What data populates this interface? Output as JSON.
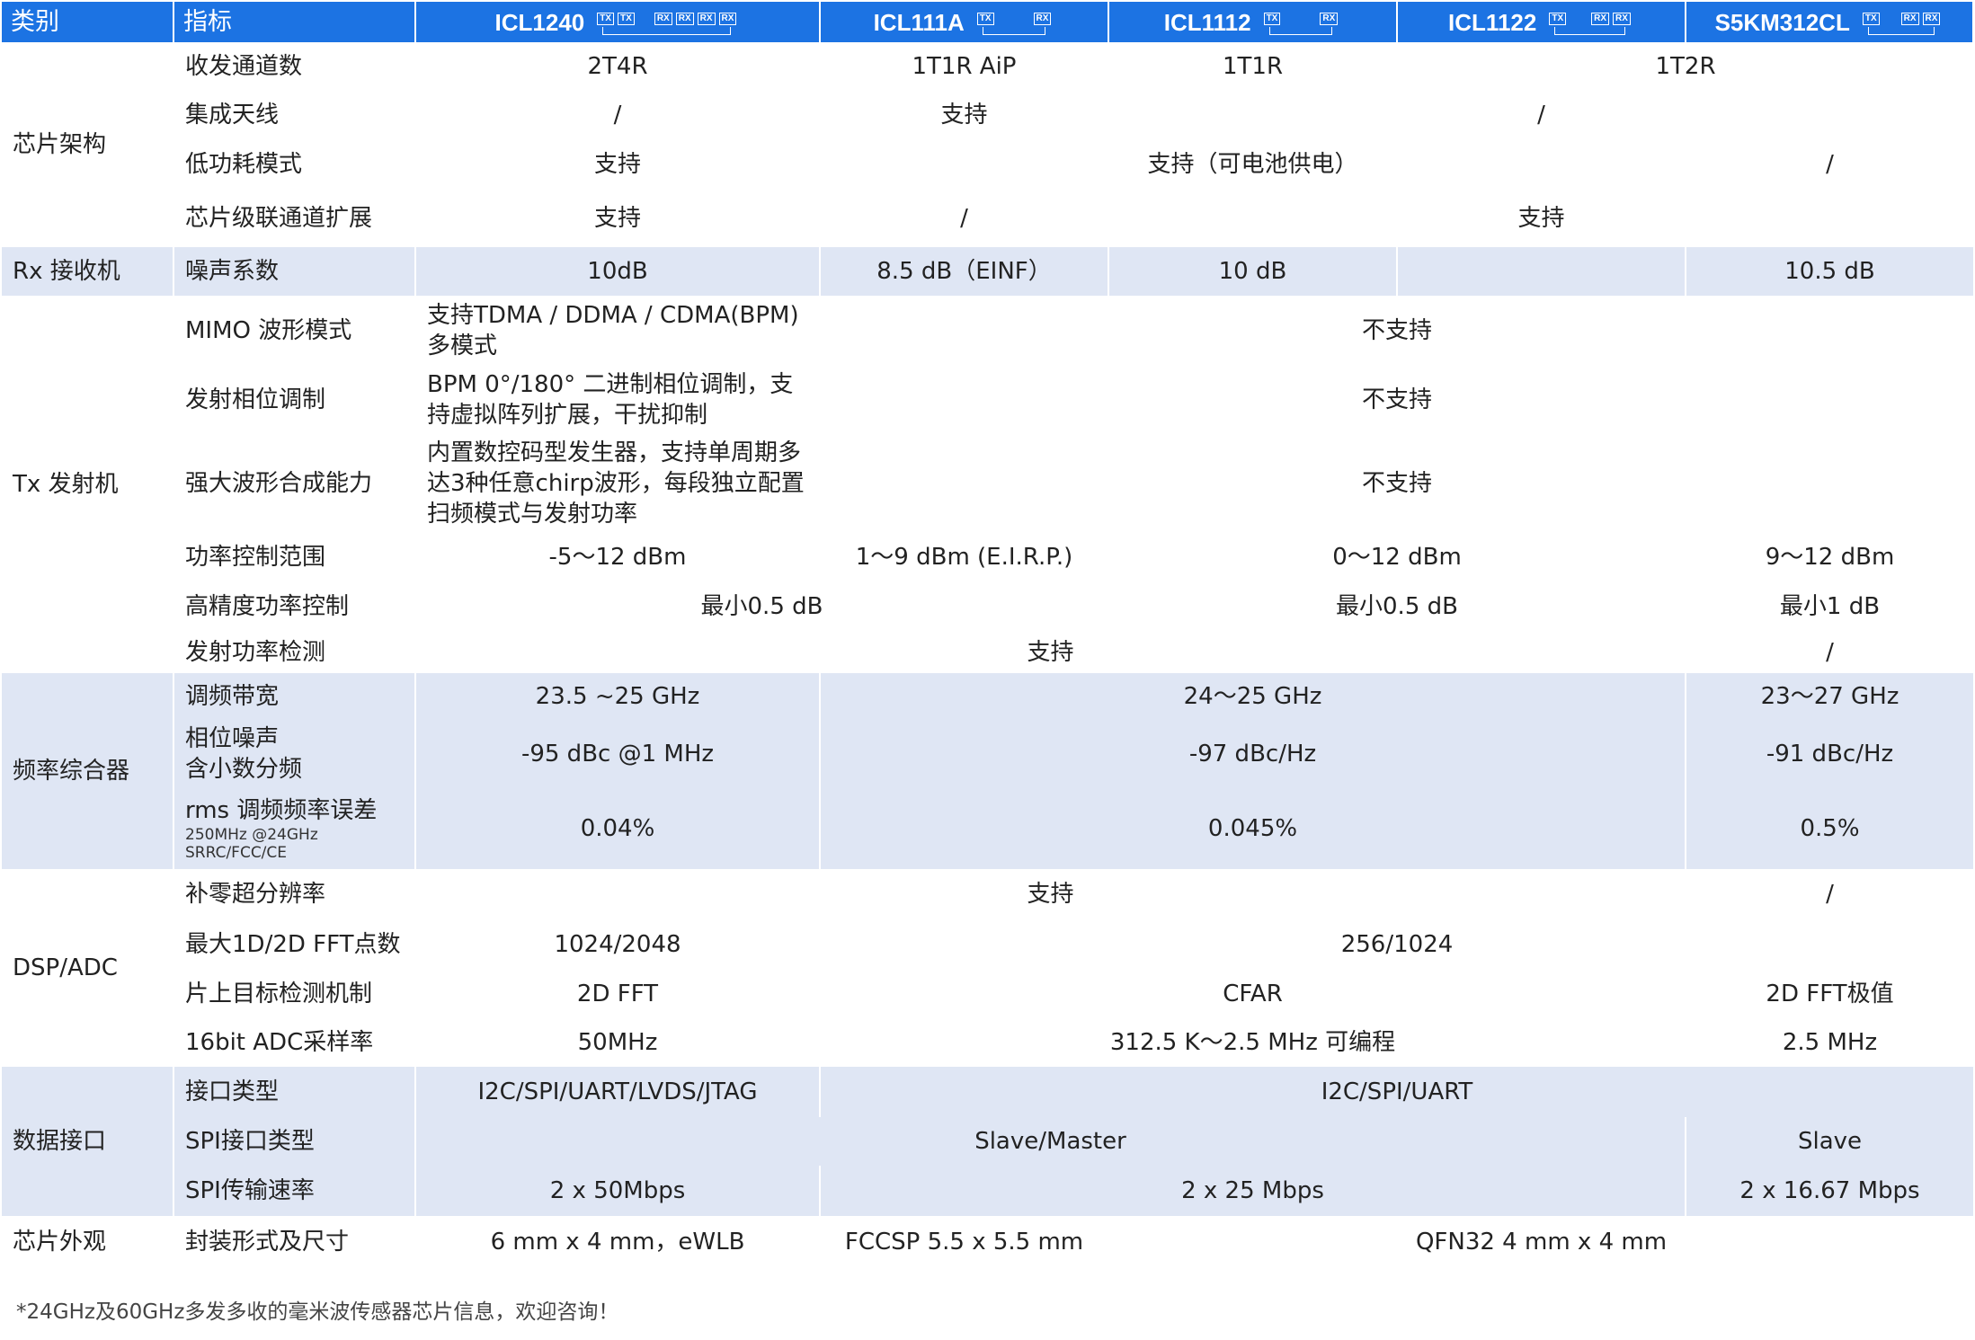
{
  "header": {
    "category": "类别",
    "indicator": "指标",
    "chips": [
      {
        "name": "ICL1240",
        "pins": [
          "TX",
          "TX",
          "RX",
          "RX",
          "RX",
          "RX"
        ]
      },
      {
        "name": "ICL111A",
        "pins": [
          "TX",
          "RX"
        ]
      },
      {
        "name": "ICL1112",
        "pins": [
          "TX",
          "RX"
        ]
      },
      {
        "name": "ICL1122",
        "pins": [
          "TX",
          "RX",
          "RX"
        ]
      },
      {
        "name": "S5KM312CL",
        "pins": [
          "TX",
          "RX",
          "RX"
        ]
      }
    ]
  },
  "sections": {
    "arch": {
      "category": "芯片架构",
      "rows": [
        {
          "indicator": "收发通道数",
          "v1": "2T4R",
          "v2": "1T1R AiP",
          "v3": "1T1R",
          "v4": "1T2R"
        },
        {
          "indicator": "集成天线",
          "v1": "/",
          "v2": "支持",
          "v3": "/"
        },
        {
          "indicator": "低功耗模式",
          "v1": "支持",
          "v2": "支持（可电池供电）",
          "v3": "/"
        },
        {
          "indicator": "芯片级联通道扩展",
          "v1": "支持",
          "v2": "/",
          "v3": "支持"
        }
      ]
    },
    "rx": {
      "category": "Rx 接收机",
      "rows": [
        {
          "indicator": "噪声系数",
          "v1": "10dB",
          "v2": "8.5 dB（EINF）",
          "v3": "10 dB",
          "v4": "",
          "v5": "10.5 dB"
        }
      ]
    },
    "tx": {
      "category": "Tx 发射机",
      "rows": [
        {
          "indicator": "MIMO 波形模式",
          "v1": "支持TDMA / DDMA / CDMA(BPM)多模式",
          "v2": "不支持"
        },
        {
          "indicator": "发射相位调制",
          "v1": "BPM 0°/180° 二进制相位调制，支持虚拟阵列扩展，干扰抑制",
          "v2": "不支持"
        },
        {
          "indicator": "强大波形合成能力",
          "v1": "内置数控码型发生器，支持单周期多达3种任意chirp波形，每段独立配置扫频模式与发射功率",
          "v2": "不支持"
        },
        {
          "indicator": "功率控制范围",
          "v1": "-5～12 dBm",
          "v2": "1～9 dBm (E.I.R.P.)",
          "v3": "0～12 dBm",
          "v4": "9～12 dBm"
        },
        {
          "indicator": "高精度功率控制",
          "v1": "最小0.5 dB",
          "v2": "最小0.5 dB",
          "v3": "最小1 dB"
        },
        {
          "indicator": "发射功率检测",
          "v1": "支持",
          "v2": "/"
        }
      ]
    },
    "freq": {
      "category": "频率综合器",
      "rows": [
        {
          "indicator": "调频带宽",
          "v1": "23.5 ~25 GHz",
          "v2": "24～25 GHz",
          "v3": "23～27 GHz"
        },
        {
          "indicator": "相位噪声",
          "sub": "含小数分频",
          "v1": "-95 dBc @1 MHz",
          "v2": "-97 dBc/Hz",
          "v3": "-91 dBc/Hz"
        },
        {
          "indicator": "rms 调频频率误差",
          "note1": "250MHz @24GHz",
          "note2": "SRRC/FCC/CE",
          "v1": "0.04%",
          "v2": "0.045%",
          "v3": "0.5%"
        }
      ]
    },
    "dsp": {
      "category": "DSP/ADC",
      "rows": [
        {
          "indicator": "补零超分辨率",
          "v1": "支持",
          "v2": "/"
        },
        {
          "indicator": "最大1D/2D FFT点数",
          "v1": "1024/2048",
          "v2": "256/1024"
        },
        {
          "indicator": "片上目标检测机制",
          "v1": "2D FFT",
          "v2": "CFAR",
          "v3": "2D FFT极值"
        },
        {
          "indicator": "16bit ADC采样率",
          "v1": "50MHz",
          "v2": "312.5 K～2.5 MHz 可编程",
          "v3": "2.5 MHz"
        }
      ]
    },
    "iface": {
      "category": "数据接口",
      "rows": [
        {
          "indicator": "接口类型",
          "v1": "I2C/SPI/UART/LVDS/JTAG",
          "v2": "I2C/SPI/UART"
        },
        {
          "indicator": "SPI接口类型",
          "v1": "Slave/Master",
          "v2": "Slave"
        },
        {
          "indicator": "SPI传输速率",
          "v1": "2 x 50Mbps",
          "v2": "2 x 25 Mbps",
          "v3": "2 x 16.67 Mbps"
        }
      ]
    },
    "pkg": {
      "category": "芯片外观",
      "rows": [
        {
          "indicator": "封装形式及尺寸",
          "v1": "6 mm x 4 mm，eWLB",
          "v2": "FCCSP 5.5 x 5.5 mm",
          "v3": "QFN32  4 mm x 4 mm"
        }
      ]
    }
  },
  "footnote": "*24GHz及60GHz多发多收的毫米波传感器芯片信息，欢迎咨询！",
  "colors": {
    "header_bg": "#1c73e3",
    "header_text": "#ffffff",
    "band": "#dfe6f4",
    "text": "#222222"
  }
}
